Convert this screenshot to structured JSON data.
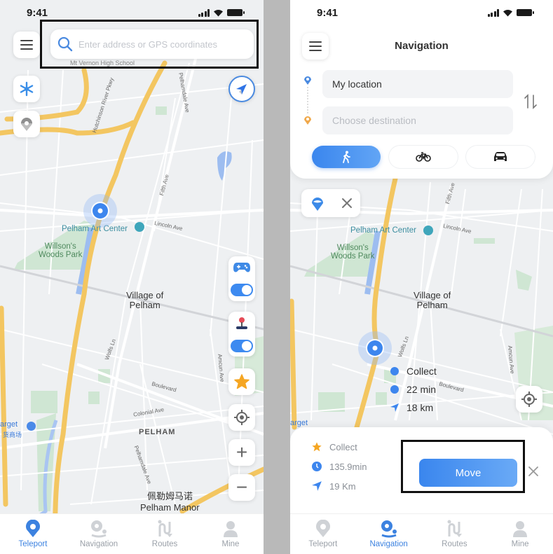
{
  "colors": {
    "accent": "#3c82e0",
    "road_major": "#f3c661",
    "park": "#cde6d0",
    "water": "#9dbdf0",
    "star": "#f5a623",
    "divider": "#b9b9b9"
  },
  "left_screen": {
    "status_bar": {
      "time": "9:41"
    },
    "search": {
      "placeholder": "Enter address or GPS coordinates",
      "value": "",
      "icon": "search-icon"
    },
    "buttons": {
      "menu": "menu-icon",
      "freeze": "snowflake-icon",
      "pokeball": "pokeball-icon",
      "compass": "compass-icon",
      "joystick_gamepad": "gamepad-icon",
      "joystick": "joystick-icon",
      "favorite": "star-icon",
      "locate": "locate-icon",
      "zoom_in": "+",
      "zoom_out": "−"
    },
    "toggles": {
      "gamepad_enabled": true,
      "joystick_enabled": true
    },
    "map_labels": {
      "school": "Mt Vernon High School",
      "parkway": "Hutchinson River Pkwy",
      "pelhamdale": "Pelhamdale Ave",
      "fifth": "Fifth Ave",
      "lincoln": "Lincoln Ave",
      "art_center": "Pelham Art Center",
      "park": "Willson's\nWoods Park",
      "village": "Village of\nPelham",
      "wolfs": "Wolfs Ln",
      "boulevard": "Boulevard",
      "colonial": "Colonial Ave",
      "pelham": "PELHAM",
      "pelhamdale2": "Pelhamdale Ave",
      "target": "arget",
      "target_cn": "货商场",
      "manor_cn": "佩勒姆马诺",
      "manor": "Pelham Manor",
      "amcun": "Amcun Ave"
    },
    "tabs": [
      {
        "label": "Teleport",
        "icon": "teleport-icon",
        "active": true
      },
      {
        "label": "Navigation",
        "icon": "navigation-icon",
        "active": false
      },
      {
        "label": "Routes",
        "icon": "routes-icon",
        "active": false
      },
      {
        "label": "Mine",
        "icon": "user-icon",
        "active": false
      }
    ]
  },
  "right_screen": {
    "status_bar": {
      "time": "9:41"
    },
    "title": "Navigation",
    "origin": {
      "value": "My location",
      "placeholder": ""
    },
    "destination": {
      "value": "",
      "placeholder": "Choose destination"
    },
    "swap_icon": "swap-icon",
    "modes": [
      {
        "name": "walk",
        "icon": "walk-icon",
        "active": true
      },
      {
        "name": "bike",
        "icon": "bike-icon",
        "active": false
      },
      {
        "name": "car",
        "icon": "car-icon",
        "active": false
      }
    ],
    "map_labels": {
      "art_center": "Pelham Art Center",
      "lincoln": "Lincoln Ave",
      "park": "Willson's\nWoods Park",
      "village": "Village of\nPelham",
      "wolfs": "Wolfs Ln",
      "boulevard": "Boulevard",
      "amcun": "Amcun Ave",
      "target": "arget",
      "fifth": "Fifth Ave"
    },
    "route_info_map": [
      {
        "icon": "collect-dot-icon",
        "text": "Collect"
      },
      {
        "icon": "clock-dot-icon",
        "text": "22 min"
      },
      {
        "icon": "arrow-icon",
        "text": "18 km"
      }
    ],
    "sheet": {
      "rows": [
        {
          "icon": "star-icon",
          "text": "Collect"
        },
        {
          "icon": "clock-icon",
          "text": "135.9min"
        },
        {
          "icon": "arrow-icon",
          "text": "19 Km"
        }
      ],
      "move_label": "Move",
      "close": "close-icon"
    },
    "tabs": [
      {
        "label": "Teleport",
        "icon": "teleport-icon",
        "active": false
      },
      {
        "label": "Navigation",
        "icon": "navigation-icon",
        "active": true
      },
      {
        "label": "Routes",
        "icon": "routes-icon",
        "active": false
      },
      {
        "label": "Mine",
        "icon": "user-icon",
        "active": false
      }
    ]
  }
}
